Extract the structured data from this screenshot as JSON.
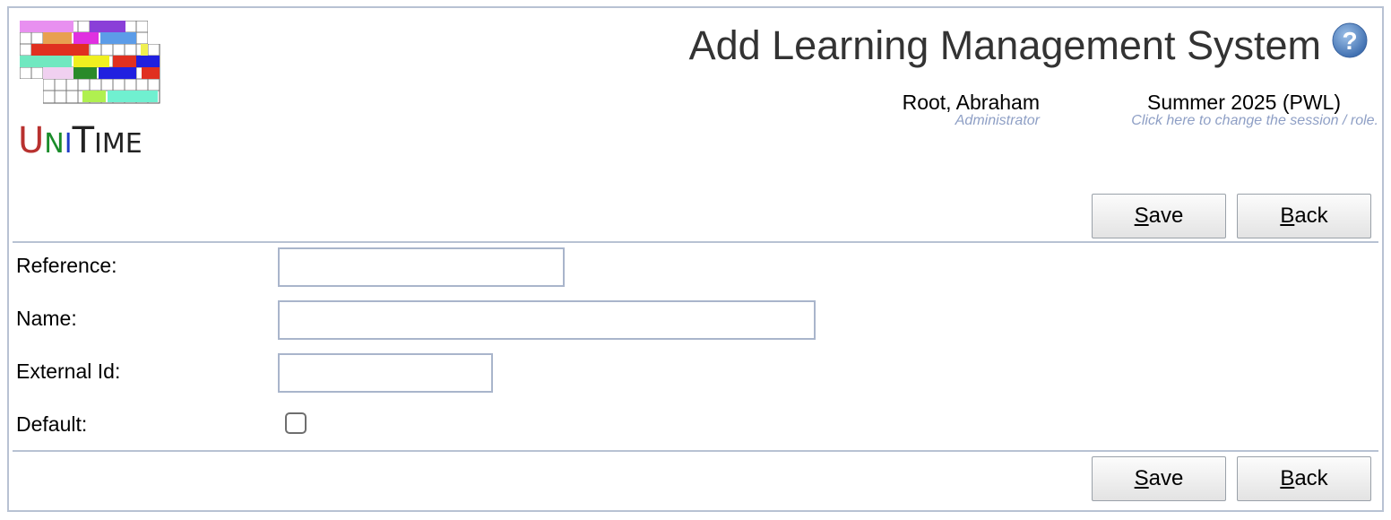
{
  "header": {
    "logo_text": "UniTime",
    "title": "Add Learning Management System",
    "help_icon": "question-mark-icon"
  },
  "user": {
    "name": "Root, Abraham",
    "role": "Administrator"
  },
  "session": {
    "name": "Summer 2025 (PWL)",
    "hint": "Click here to change the session / role."
  },
  "buttons": {
    "save": {
      "accel": "S",
      "rest": "ave"
    },
    "back": {
      "accel": "B",
      "rest": "ack"
    }
  },
  "form": {
    "reference": {
      "label": "Reference:",
      "value": ""
    },
    "name": {
      "label": "Name:",
      "value": ""
    },
    "external_id": {
      "label": "External Id:",
      "value": ""
    },
    "default": {
      "label": "Default:",
      "checked": false
    }
  },
  "colors": {
    "border": "#b8c2d3",
    "title": "#333333",
    "hint": "#8e9fc5"
  }
}
